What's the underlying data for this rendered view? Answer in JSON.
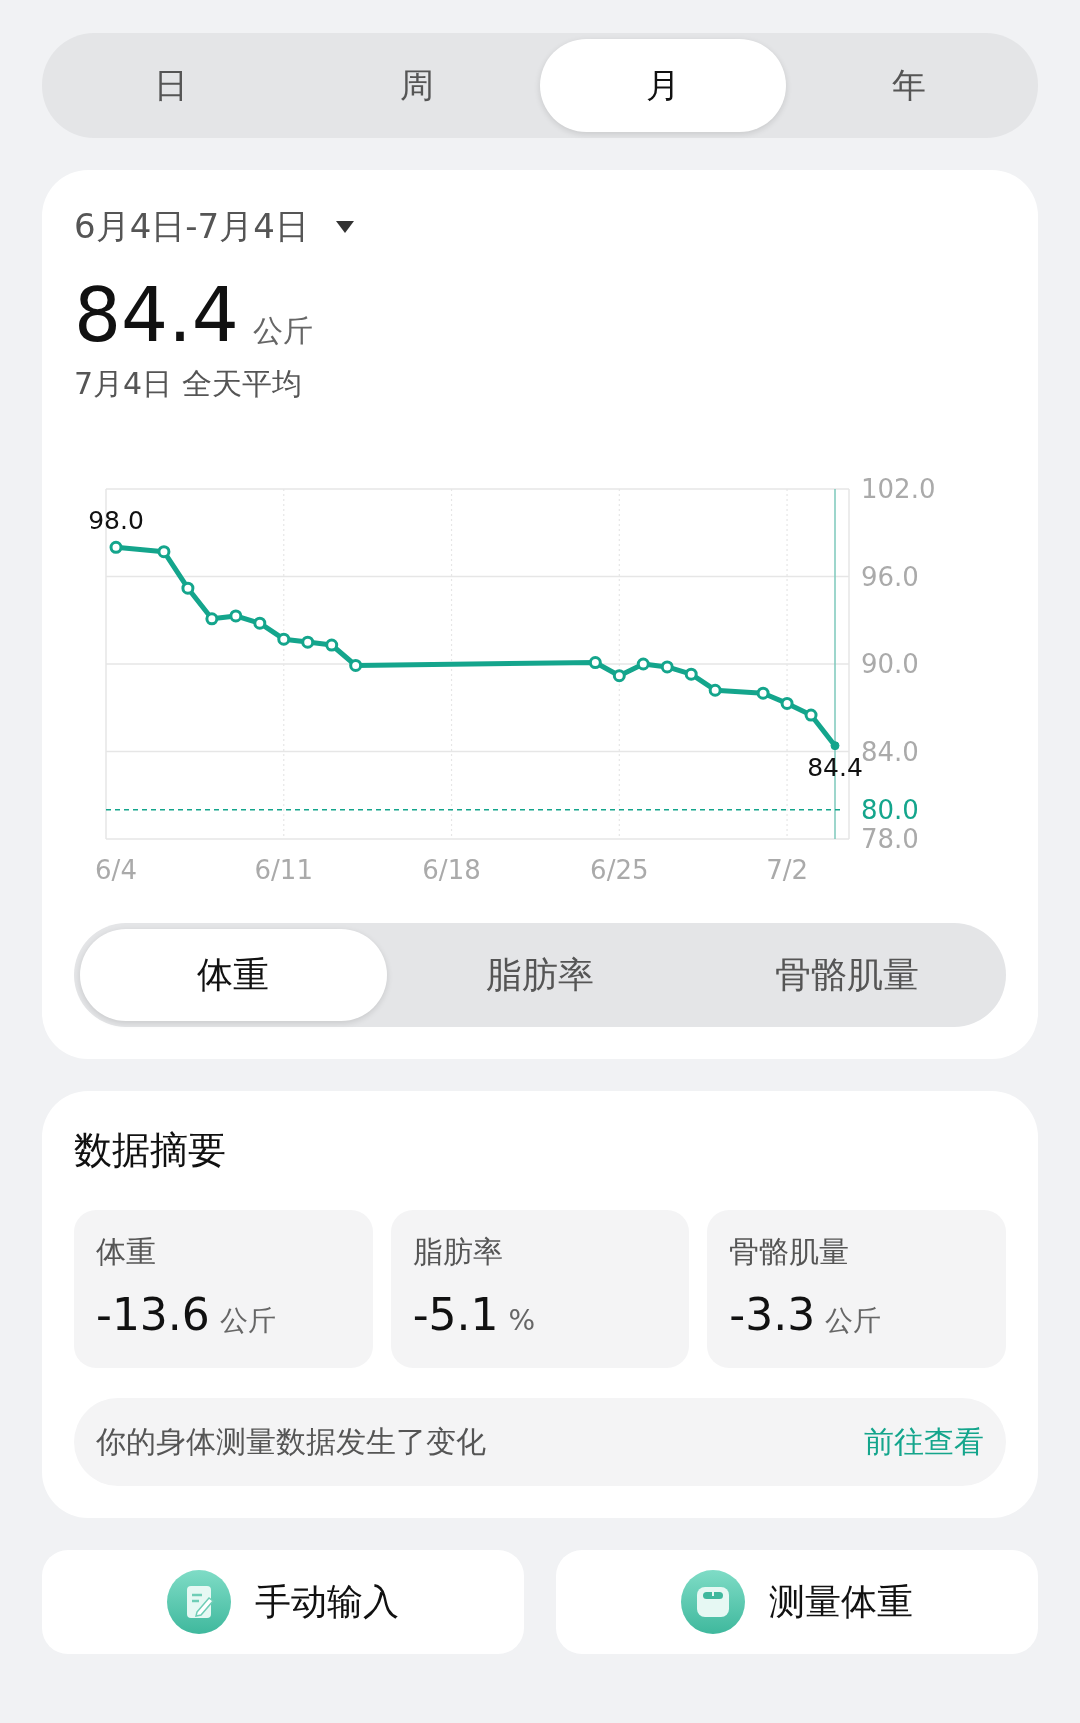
{
  "period_tabs": [
    {
      "label": "日",
      "selected": false
    },
    {
      "label": "周",
      "selected": false
    },
    {
      "label": "月",
      "selected": true
    },
    {
      "label": "年",
      "selected": false
    }
  ],
  "overview": {
    "date_range": "6月4日-7月4日",
    "value": "84.4",
    "unit": "公斤",
    "subtitle": "7月4日 全天平均",
    "chart_data": {
      "type": "line",
      "categories": [
        "6/4",
        null,
        null,
        null,
        null,
        null,
        null,
        "6/11",
        null,
        null,
        null,
        null,
        null,
        null,
        "6/18",
        null,
        null,
        null,
        null,
        null,
        null,
        "6/25",
        null,
        null,
        null,
        null,
        null,
        null,
        "7/2",
        null,
        null
      ],
      "grid": true,
      "series": [
        {
          "color": "#14a58c",
          "marker": true,
          "values": [
            98.0,
            null,
            97.7,
            95.2,
            93.1,
            93.3,
            92.8,
            91.7,
            91.5,
            91.3,
            89.9,
            null,
            null,
            null,
            null,
            null,
            null,
            null,
            null,
            null,
            90.1,
            89.2,
            90.0,
            89.8,
            89.3,
            88.2,
            null,
            88.0,
            87.3,
            86.5,
            84.4
          ]
        }
      ],
      "ylim": [
        78,
        102
      ],
      "yticks": [
        {
          "value": 102,
          "label": "102.0"
        },
        {
          "value": 96,
          "label": "96.0"
        },
        {
          "value": 90,
          "label": "90.0"
        },
        {
          "value": 84,
          "label": "84.0"
        },
        {
          "value": 78,
          "label": "78.0"
        }
      ],
      "annotations": [
        {
          "x": "6/4",
          "y": 98.0,
          "text": "98.0"
        },
        {
          "y": 84.4,
          "text": "84.4"
        }
      ],
      "ref_lines": [
        {
          "axis": "y",
          "value": 80,
          "color": "#14a58c",
          "label": "80.0"
        }
      ]
    },
    "metric_tabs": [
      {
        "label": "体重",
        "selected": true
      },
      {
        "label": "脂肪率",
        "selected": false
      },
      {
        "label": "骨骼肌量",
        "selected": false
      }
    ]
  },
  "summary": {
    "title": "数据摘要",
    "cards": [
      {
        "label": "体重",
        "value": "-13.6",
        "unit": "公斤"
      },
      {
        "label": "脂肪率",
        "value": "-5.1",
        "unit": "%"
      },
      {
        "label": "骨骼肌量",
        "value": "-3.3",
        "unit": "公斤"
      }
    ],
    "notice": {
      "text": "你的身体测量数据发生了变化",
      "link": "前往查看"
    }
  },
  "actions": [
    {
      "kind": "manual",
      "label": "手动输入"
    },
    {
      "kind": "measure",
      "label": "测量体重"
    }
  ]
}
